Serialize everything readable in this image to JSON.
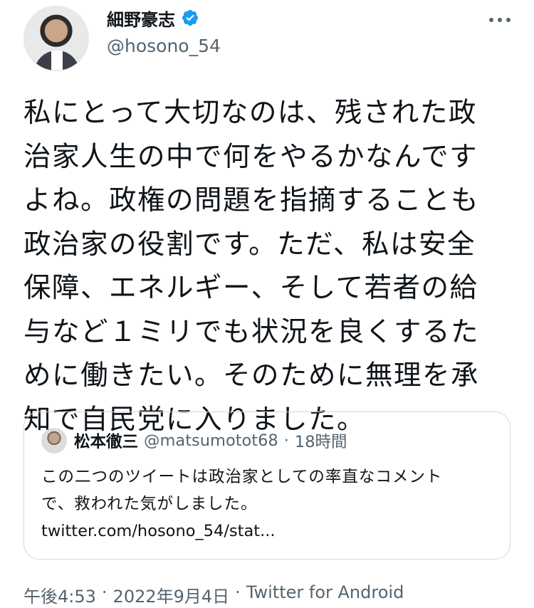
{
  "user": {
    "name": "細野豪志",
    "handle": "@hosono_54",
    "verified": true,
    "accent": "#1d9bf0"
  },
  "tweet": {
    "text": "私にとって大切なのは、残された政\n治家人生の中で何をやるかなんです\nよね。政権の問題を指摘することも\n政治家の役割です。ただ、私は安全\n保障、エネルギー、そして若者の給\n与など１ミリでも状況を良くするた\nめに働きたい。そのために無理を承\n知で自民党に入りました。"
  },
  "quote": {
    "name": "松本徹三",
    "handle": "@matsumotot68",
    "separator": "·",
    "time": "18時間",
    "text": "この二つのツイートは政治家としての率直なコメント\nで、救われた気がしました。",
    "link": "twitter.com/hosono_54/stat..."
  },
  "meta": {
    "time": "午後4:53",
    "sep1": "·",
    "date": "2022年9月4日",
    "sep2": "·",
    "client": "Twitter for Android"
  },
  "icons": {
    "more": "more-horizontal-icon",
    "verified": "verified-badge-icon"
  }
}
